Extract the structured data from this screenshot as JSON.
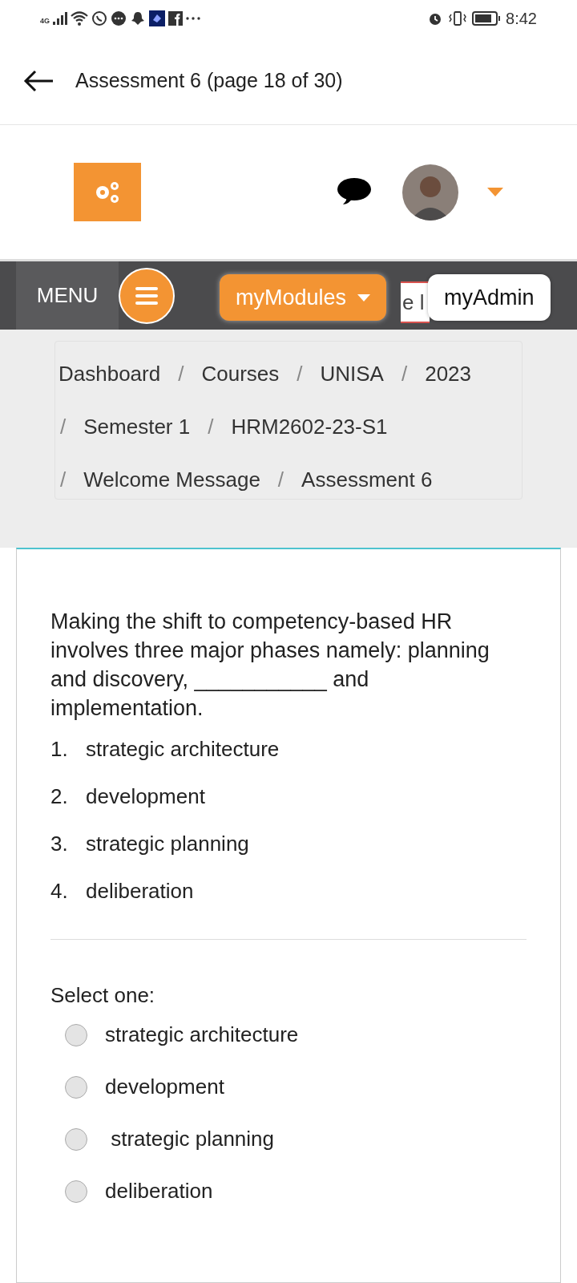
{
  "status_bar": {
    "network": "4G",
    "time": "8:42"
  },
  "app_bar": {
    "title": "Assessment 6 (page 18 of 30)"
  },
  "nav": {
    "menu_label": "MENU",
    "search_fragment": "e l",
    "modules_button": "myModules",
    "admin_button": "myAdmin"
  },
  "breadcrumb": [
    [
      {
        "text": "Dashboard",
        "kind": "link"
      },
      {
        "text": "/",
        "kind": "separator"
      },
      {
        "text": "Courses",
        "kind": "link"
      },
      {
        "text": "/",
        "kind": "separator"
      },
      {
        "text": "UNISA",
        "kind": "link"
      },
      {
        "text": "/",
        "kind": "separator"
      },
      {
        "text": "2023",
        "kind": "link"
      }
    ],
    [
      {
        "text": "/",
        "kind": "separator"
      },
      {
        "text": "Semester 1",
        "kind": "link"
      },
      {
        "text": "/",
        "kind": "separator"
      },
      {
        "text": "HRM2602-23-S1",
        "kind": "link"
      }
    ],
    [
      {
        "text": "/",
        "kind": "separator"
      },
      {
        "text": "Welcome Message",
        "kind": "link"
      },
      {
        "text": "/",
        "kind": "separator"
      },
      {
        "text": "Assessment 6",
        "kind": "link"
      }
    ]
  ],
  "question": {
    "text": "Making the shift to competency-based HR involves three major phases namely: planning and discovery, ___________ and implementation.",
    "list": [
      {
        "number": "1.",
        "text": "strategic architecture"
      },
      {
        "number": "2.",
        "text": "development"
      },
      {
        "number": "3.",
        "text": "strategic planning"
      },
      {
        "number": "4.",
        "text": "deliberation"
      }
    ],
    "prompt": "Select one:",
    "options": [
      {
        "label": "strategic architecture",
        "selected": false
      },
      {
        "label": "development",
        "selected": false
      },
      {
        "label": " strategic planning",
        "selected": false
      },
      {
        "label": "deliberation",
        "selected": false
      }
    ]
  }
}
